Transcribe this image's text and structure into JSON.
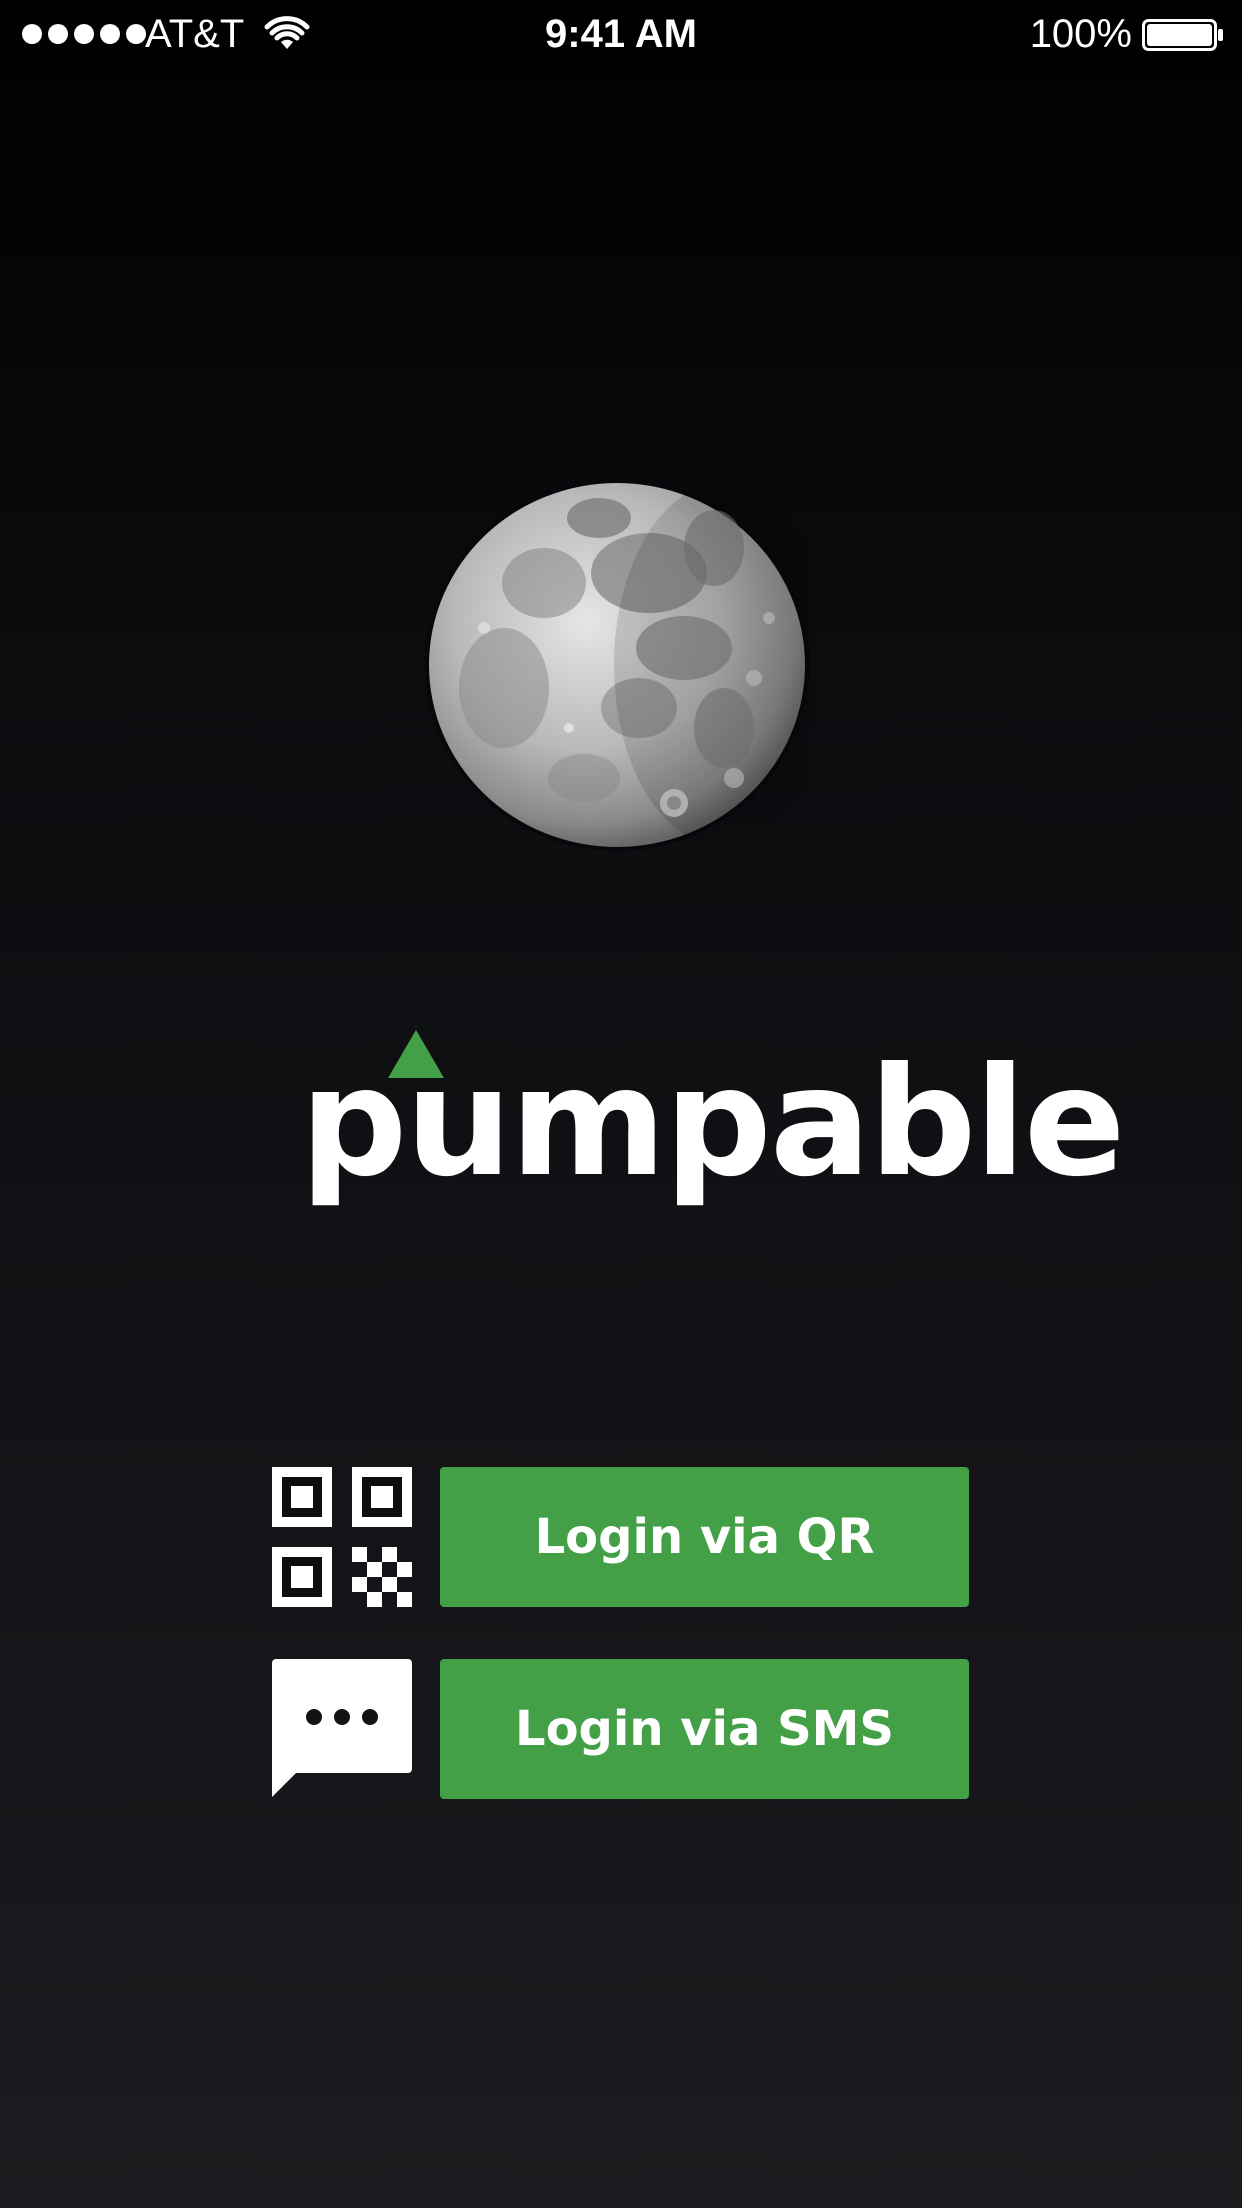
{
  "status_bar": {
    "carrier": "AT&T",
    "time": "9:41 AM",
    "battery_percent": "100%",
    "signal_bars": 5,
    "battery_level": 1.0
  },
  "logo": {
    "text": "pumpable",
    "accent_color": "#43a047"
  },
  "login": {
    "qr": {
      "label": "Login via QR",
      "icon": "qr-code-icon"
    },
    "sms": {
      "label": "Login via SMS",
      "icon": "chat-bubble-icon"
    }
  },
  "colors": {
    "brand_green": "#43a047",
    "background_top": "#000000",
    "background_bottom": "#1a1c1f",
    "text": "#ffffff"
  }
}
